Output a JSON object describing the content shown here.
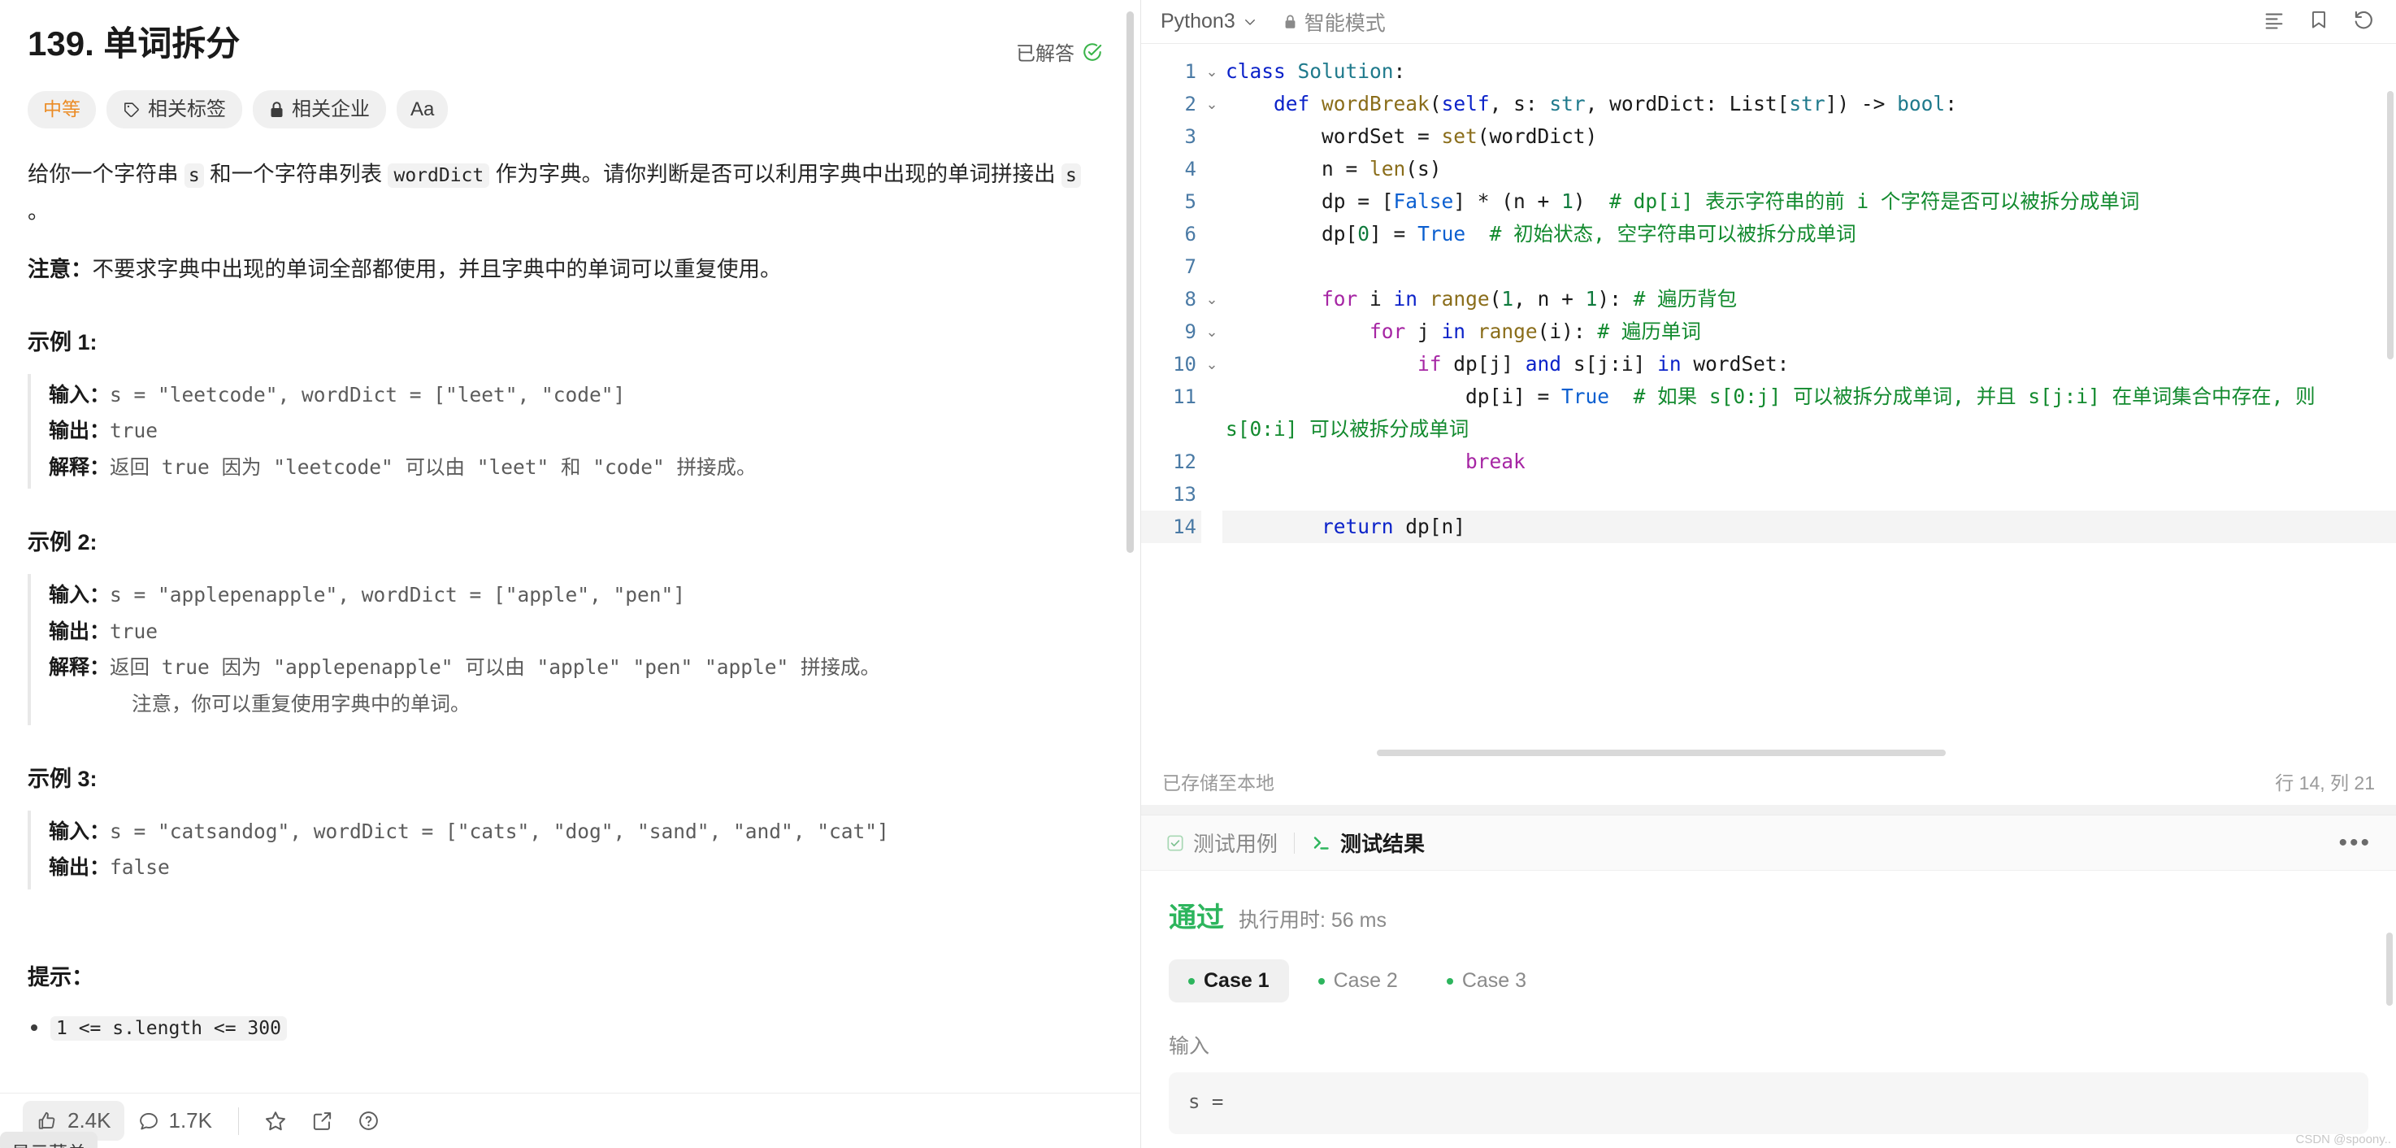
{
  "problem": {
    "title": "139. 单词拆分",
    "solved_label": "已解答",
    "tags": [
      {
        "name": "difficulty-tag",
        "label": "中等",
        "icon": ""
      },
      {
        "name": "related-tags",
        "label": "相关标签",
        "icon": "tag-icon"
      },
      {
        "name": "related-companies",
        "label": "相关企业",
        "icon": "lock-icon"
      },
      {
        "name": "font-size-toggle",
        "label": "Aa",
        "icon": ""
      }
    ],
    "description": {
      "line1_a": "给你一个字符串 ",
      "code_s": "s",
      "line1_b": " 和一个字符串列表 ",
      "code_worddict": "wordDict",
      "line1_c": " 作为字典。请你判断是否可以利用字典中出现的单词拼接出 ",
      "code_s2": "s",
      "line1_d": " 。",
      "note_label": "注意：",
      "note_text": "不要求字典中出现的单词全部都使用，并且字典中的单词可以重复使用。"
    },
    "examples": [
      {
        "heading": "示例 1:",
        "input_label": "输入：",
        "input_value": "s = \"leetcode\", wordDict = [\"leet\", \"code\"]",
        "output_label": "输出：",
        "output_value": "true",
        "explain_label": "解释：",
        "explain_value": "返回 true 因为 \"leetcode\" 可以由 \"leet\" 和 \"code\" 拼接成。",
        "explain_extra": ""
      },
      {
        "heading": "示例 2:",
        "input_label": "输入：",
        "input_value": "s = \"applepenapple\", wordDict = [\"apple\", \"pen\"]",
        "output_label": "输出：",
        "output_value": "true",
        "explain_label": "解释：",
        "explain_value": "返回 true 因为 \"applepenapple\" 可以由 \"apple\" \"pen\" \"apple\" 拼接成。",
        "explain_extra": "注意，你可以重复使用字典中的单词。"
      },
      {
        "heading": "示例 3:",
        "input_label": "输入：",
        "input_value": "s = \"catsandog\", wordDict = [\"cats\", \"dog\", \"sand\", \"and\", \"cat\"]",
        "output_label": "输出：",
        "output_value": "false",
        "explain_label": "",
        "explain_value": "",
        "explain_extra": ""
      }
    ],
    "hints_heading": "提示：",
    "hints": [
      "1 <= s.length <= 300"
    ]
  },
  "left_toolbar": {
    "likes": "2.4K",
    "comments": "1.7K",
    "tooltip": "显示菜单"
  },
  "editor": {
    "language": "Python3",
    "smart_mode": "智能模式",
    "saved_status": "已存储至本地",
    "cursor_status": "行 14, 列 21",
    "lines": [
      {
        "num": "1",
        "fold": "⌄",
        "indent": 0
      },
      {
        "num": "2",
        "fold": "⌄",
        "indent": 1
      },
      {
        "num": "3",
        "fold": "",
        "indent": 2
      },
      {
        "num": "4",
        "fold": "",
        "indent": 2
      },
      {
        "num": "5",
        "fold": "",
        "indent": 2
      },
      {
        "num": "6",
        "fold": "",
        "indent": 2
      },
      {
        "num": "7",
        "fold": "",
        "indent": 0
      },
      {
        "num": "8",
        "fold": "⌄",
        "indent": 2
      },
      {
        "num": "9",
        "fold": "⌄",
        "indent": 3
      },
      {
        "num": "10",
        "fold": "⌄",
        "indent": 4
      },
      {
        "num": "11",
        "fold": "",
        "indent": 5
      },
      {
        "num": "12",
        "fold": "",
        "indent": 5
      },
      {
        "num": "13",
        "fold": "",
        "indent": 0
      },
      {
        "num": "14",
        "fold": "",
        "indent": 2
      }
    ],
    "code_text": "class Solution:\n    def wordBreak(self, s: str, wordDict: List[str]) -> bool:\n        wordSet = set(wordDict)\n        n = len(s)\n        dp = [False] * (n + 1)  # dp[i] 表示字符串的前 i 个字符是否可以被拆分成单词\n        dp[0] = True  # 初始状态, 空字符串可以被拆分成单词\n\n        for i in range(1, n + 1): # 遍历背包\n            for j in range(i): # 遍历单词\n                if dp[j] and s[j:i] in wordSet:\n                    dp[i] = True  # 如果 s[0:j] 可以被拆分成单词, 并且 s[j:i] 在单词集合中存在, 则 s[0:i] 可以被拆分成单词\n                    break\n\n        return dp[n]"
  },
  "test_panel": {
    "tab_testcase": "测试用例",
    "tab_result": "测试结果",
    "verdict": "通过",
    "runtime": "执行用时: 56 ms",
    "cases": [
      "Case 1",
      "Case 2",
      "Case 3"
    ],
    "active_case": "Case 1",
    "input_label": "输入",
    "input_value": "s ="
  },
  "watermark": "CSDN @spoony.."
}
